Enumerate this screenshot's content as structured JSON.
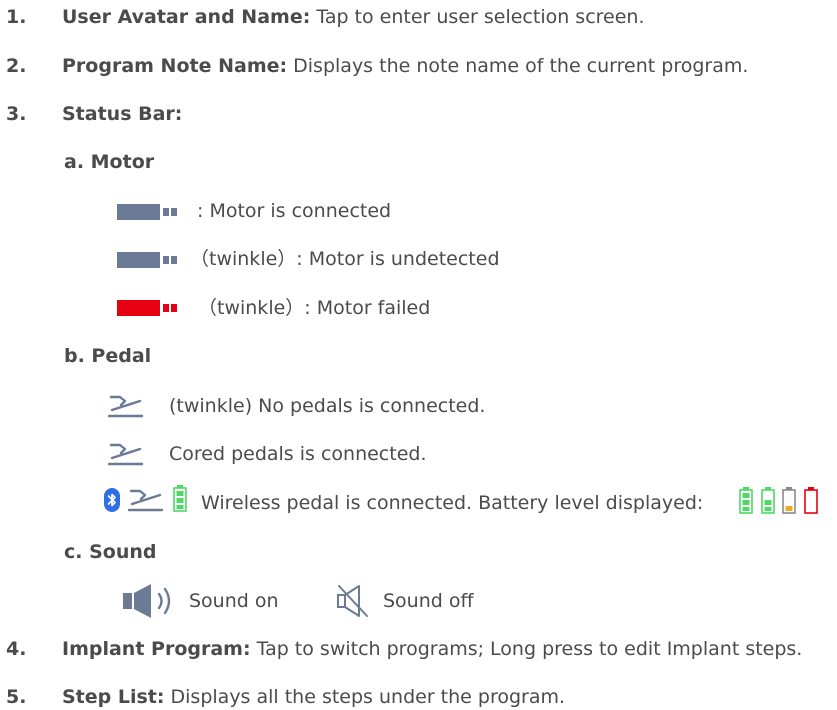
{
  "items": [
    {
      "num": "1.",
      "title": "User Avatar and Name:",
      "text": " Tap to enter user selection screen."
    },
    {
      "num": "2.",
      "title": "Program Note Name:",
      "text": " Displays the note name of the current program."
    },
    {
      "num": "3.",
      "title": "Status Bar:",
      "text": ""
    },
    {
      "num": "4.",
      "title": "Implant Program:",
      "text": " Tap to switch programs; Long press to edit Implant steps."
    },
    {
      "num": "5.",
      "title": "Step List:",
      "text": " Displays all the steps under the program."
    }
  ],
  "motor": {
    "heading": "a.  Motor",
    "connected": ": Motor is connected",
    "undetected": "（twinkle）: Motor is undetected",
    "failed": "（twinkle）: Motor failed"
  },
  "pedal": {
    "heading": "b.  Pedal",
    "none": "(twinkle) No pedals is connected.",
    "cored": "Cored pedals is connected.",
    "wireless": "Wireless pedal is connected. Battery level displayed:"
  },
  "sound": {
    "heading": "c.  Sound",
    "on": "Sound on",
    "off": "Sound off"
  },
  "icons": [
    "motor-icon",
    "motor-failed-icon",
    "pedal-icon",
    "bluetooth-icon",
    "battery-icon",
    "speaker-on-icon",
    "speaker-off-icon"
  ],
  "colors": {
    "motor": "#6b7a95",
    "motor_failed": "#e60012",
    "pedal": "#6b7a95",
    "bluetooth": "#2f6fe6",
    "battery_green": "#4cd964",
    "battery_orange": "#f5a623",
    "battery_red": "#e60012"
  },
  "battery_levels": [
    1.0,
    0.67,
    0.33,
    0.0
  ]
}
